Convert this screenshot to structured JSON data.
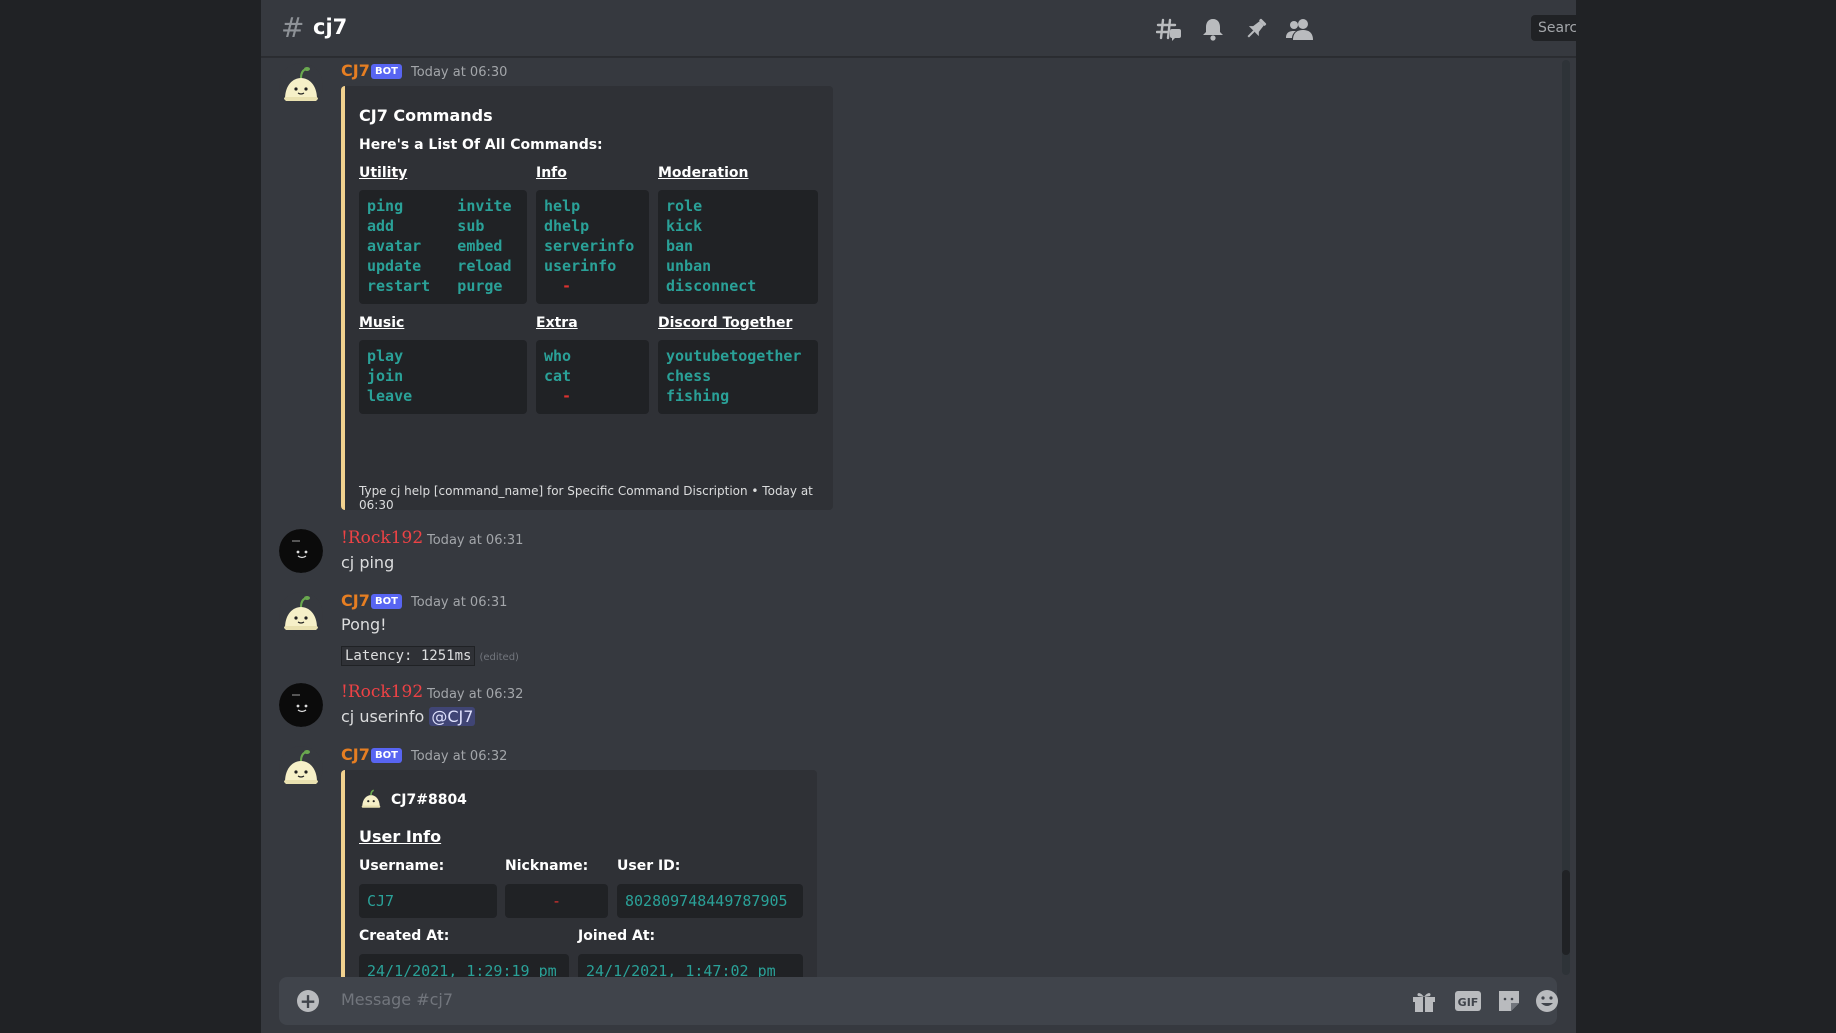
{
  "channel": {
    "hash": "#",
    "name": "cj7"
  },
  "search": {
    "placeholder": "Search"
  },
  "icons": [
    "threads-icon",
    "bell-icon",
    "pin-icon",
    "members-icon",
    "plus-circle-icon",
    "gift-icon",
    "gif-icon",
    "sticker-icon",
    "emoji-icon"
  ],
  "colors": {
    "bot_name": "#e67e22",
    "user_name": "#ed4245",
    "embed_border": "#f2d28f",
    "code_green": "#2aa198",
    "code_red": "#dc322f",
    "bot_badge": "#5865f2"
  },
  "messages": [
    {
      "author": "CJ7",
      "badge": "BOT",
      "time": "Today at 06:30",
      "embed": {
        "title": "CJ7 Commands",
        "subtitle": "Here's a List Of All Commands:",
        "fields": [
          {
            "name": "Utility",
            "lines": [
              "ping      invite",
              "add       sub",
              "avatar    embed",
              "update    reload",
              "restart   purge"
            ]
          },
          {
            "name": "Info",
            "lines": [
              "help",
              "dhelp",
              "serverinfo",
              "userinfo",
              "  -"
            ]
          },
          {
            "name": "Moderation",
            "lines": [
              "role",
              "kick",
              "ban",
              "unban",
              "disconnect"
            ]
          },
          {
            "name": "Music",
            "lines": [
              "play",
              "join",
              "leave"
            ]
          },
          {
            "name": "Extra",
            "lines": [
              "who",
              "cat",
              "  -"
            ]
          },
          {
            "name": "Discord Together",
            "lines": [
              "youtubetogether",
              "chess",
              "fishing"
            ]
          }
        ],
        "footer": "Type cj help [command_name] for Specific Command Discription • Today at 06:30"
      }
    },
    {
      "author": "!Rock192",
      "time": "Today at 06:31",
      "text": "cj ping"
    },
    {
      "author": "CJ7",
      "badge": "BOT",
      "time": "Today at 06:31",
      "text": "Pong!",
      "code": "Latency: 1251ms",
      "edited": "(edited)"
    },
    {
      "author": "!Rock192",
      "time": "Today at 06:32",
      "text": "cj userinfo",
      "mention": "@CJ7"
    },
    {
      "author": "CJ7",
      "badge": "BOT",
      "time": "Today at 06:32",
      "embed": {
        "author": "CJ7#8804",
        "title": "User Info",
        "fields": [
          {
            "name": "Username:",
            "value": "CJ7"
          },
          {
            "name": "Nickname:",
            "value": "-"
          },
          {
            "name": "User ID:",
            "value": "802809748449787905"
          },
          {
            "name": "Created At:",
            "value": "24/1/2021, 1:29:19 pm"
          },
          {
            "name": "Joined At:",
            "value": "24/1/2021, 1:47:02 pm"
          }
        ]
      }
    }
  ],
  "composer": {
    "placeholder": "Message #cj7"
  }
}
